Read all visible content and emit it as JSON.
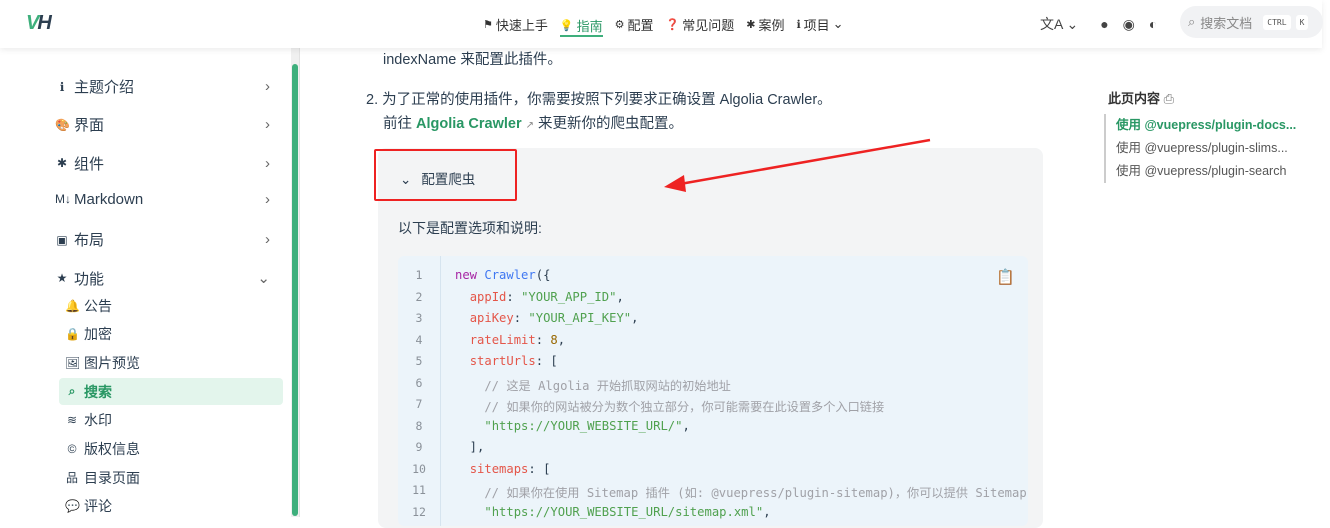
{
  "nav": {
    "logo": "VH",
    "links": [
      {
        "icon": "signpost-icon",
        "label": "快速上手"
      },
      {
        "icon": "lightbulb-icon",
        "label": "指南",
        "active": true
      },
      {
        "icon": "gears-icon",
        "label": "配置"
      },
      {
        "icon": "question-icon",
        "label": "常见问题"
      },
      {
        "icon": "puzzle-icon",
        "label": "案例"
      },
      {
        "icon": "info-icon",
        "label": "项目"
      }
    ],
    "search_placeholder": "搜索文档",
    "kbd1": "CTRL",
    "kbd2": "K"
  },
  "sidebar": {
    "groups": [
      {
        "icon": "info-icon",
        "label": "主题介绍"
      },
      {
        "icon": "palette-icon",
        "label": "界面"
      },
      {
        "icon": "puzzle-icon",
        "label": "组件"
      },
      {
        "icon": "markdown-icon",
        "label": "Markdown"
      },
      {
        "icon": "layout-icon",
        "label": "布局"
      },
      {
        "icon": "star-icon",
        "label": "功能"
      }
    ],
    "sub": [
      {
        "icon": "bell-icon",
        "label": "公告"
      },
      {
        "icon": "lock-icon",
        "label": "加密"
      },
      {
        "icon": "image-icon",
        "label": "图片预览"
      },
      {
        "icon": "search-icon",
        "label": "搜索",
        "active": true
      },
      {
        "icon": "watermark-icon",
        "label": "水印"
      },
      {
        "icon": "copyright-icon",
        "label": "版权信息"
      },
      {
        "icon": "sitemap-icon",
        "label": "目录页面"
      },
      {
        "icon": "comment-icon",
        "label": "评论"
      }
    ]
  },
  "content": {
    "prev_line": "indexName 来配置此插件。",
    "item_num": "2.",
    "item_text": "为了正常的使用插件，你需要按照下列要求正确设置 Algolia Crawler。",
    "goto": "前往",
    "link": "Algolia Crawler",
    "after_link": "来更新你的爬虫配置。",
    "summary": "配置爬虫",
    "desc": "以下是配置选项和说明:"
  },
  "code": [
    {
      "n": "1",
      "t": [
        [
          "kw",
          "new "
        ],
        [
          "fn",
          "Crawler"
        ],
        [
          "",
          "({"
        ]
      ]
    },
    {
      "n": "2",
      "t": [
        [
          "",
          "  "
        ],
        [
          "pr",
          "appId"
        ],
        [
          "",
          ": "
        ],
        [
          "st",
          "\"YOUR_APP_ID\""
        ],
        [
          "",
          ","
        ]
      ]
    },
    {
      "n": "3",
      "t": [
        [
          "",
          "  "
        ],
        [
          "pr",
          "apiKey"
        ],
        [
          "",
          ": "
        ],
        [
          "st",
          "\"YOUR_API_KEY\""
        ],
        [
          "",
          ","
        ]
      ]
    },
    {
      "n": "4",
      "t": [
        [
          "",
          "  "
        ],
        [
          "pr",
          "rateLimit"
        ],
        [
          "",
          ": "
        ],
        [
          "nm",
          "8"
        ],
        [
          "",
          ","
        ]
      ]
    },
    {
      "n": "5",
      "t": [
        [
          "",
          "  "
        ],
        [
          "pr",
          "startUrls"
        ],
        [
          "",
          ": ["
        ]
      ]
    },
    {
      "n": "6",
      "t": [
        [
          "cm",
          "    // 这是 Algolia 开始抓取网站的初始地址"
        ]
      ]
    },
    {
      "n": "7",
      "t": [
        [
          "cm",
          "    // 如果你的网站被分为数个独立部分，你可能需要在此设置多个入口链接"
        ]
      ]
    },
    {
      "n": "8",
      "t": [
        [
          "",
          "    "
        ],
        [
          "st",
          "\"https://YOUR_WEBSITE_URL/\""
        ],
        [
          "",
          ","
        ]
      ]
    },
    {
      "n": "9",
      "t": [
        [
          "",
          "  ],"
        ]
      ]
    },
    {
      "n": "10",
      "t": [
        [
          "",
          "  "
        ],
        [
          "pr",
          "sitemaps"
        ],
        [
          "",
          ": ["
        ]
      ]
    },
    {
      "n": "11",
      "t": [
        [
          "cm",
          "    // 如果你在使用 Sitemap 插件 (如: @vuepress/plugin-sitemap)，你可以提供 Sitemap 链接"
        ]
      ]
    },
    {
      "n": "12",
      "t": [
        [
          "",
          "    "
        ],
        [
          "st",
          "\"https://YOUR_WEBSITE_URL/sitemap.xml\""
        ],
        [
          "",
          ","
        ]
      ]
    }
  ],
  "toc": {
    "title": "此页内容",
    "items": [
      "使用 @vuepress/plugin-docs...",
      "使用 @vuepress/plugin-slims...",
      "使用 @vuepress/plugin-search"
    ]
  }
}
